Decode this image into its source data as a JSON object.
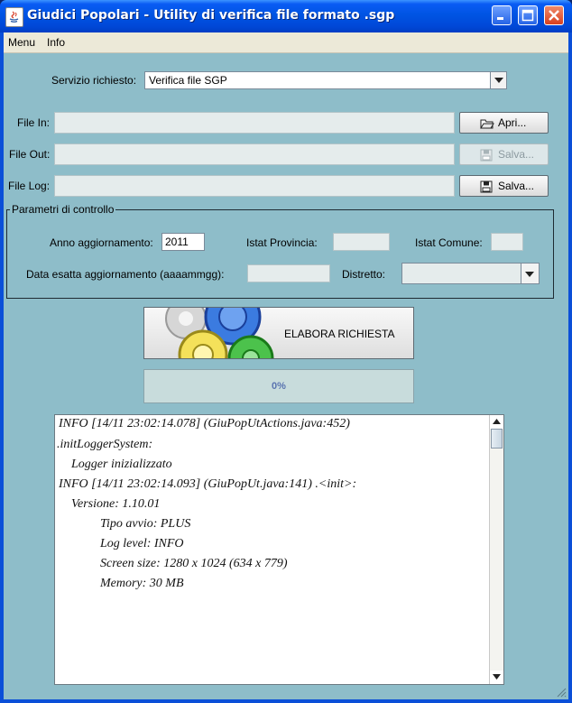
{
  "window": {
    "title": "Giudici Popolari - Utility di verifica file formato .sgp"
  },
  "menu": {
    "items": [
      "Menu",
      "Info"
    ]
  },
  "form": {
    "servizio_label": "Servizio richiesto:",
    "servizio_value": "Verifica file SGP",
    "file_in_label": "File In:",
    "file_out_label": "File Out:",
    "file_log_label": "File Log:",
    "apri_label": "Apri...",
    "salva_out_label": "Salva...",
    "salva_log_label": "Salva..."
  },
  "parametri": {
    "title": "Parametri di controllo",
    "anno_label": "Anno aggiornamento:",
    "anno_value": "2011",
    "istat_prov_label": "Istat Provincia:",
    "istat_comune_label": "Istat Comune:",
    "data_label": "Data esatta aggiornamento (aaaammgg):",
    "distretto_label": "Distretto:"
  },
  "action": {
    "elabora_label": "ELABORA RICHIESTA"
  },
  "progress": {
    "value": 0,
    "text": "0%"
  },
  "log": {
    "lines": [
      "INFO [14/11 23:02:14.078] (GiuPopUtActions.java:452)",
      ".initLoggerSystem:",
      "Logger inizializzato",
      "INFO [14/11 23:02:14.093] (GiuPopUt.java:141) .<init>:",
      "Versione: 1.10.01",
      "Tipo avvio: PLUS",
      "Log level: INFO",
      "Screen size: 1280 x 1024  (634 x 779)",
      "Memory: 30 MB"
    ]
  },
  "colors": {
    "content_bg": "#8ebdc9",
    "titlebar": "#0054e3"
  }
}
